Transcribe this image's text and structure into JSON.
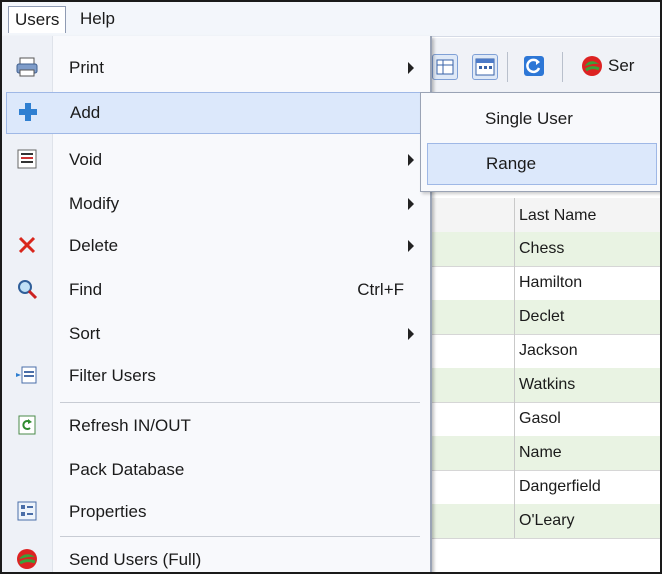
{
  "menubar": {
    "items": [
      "Users",
      "Help"
    ]
  },
  "toolbar": {
    "partial_label": "Ser"
  },
  "menu": {
    "items": [
      {
        "label": "Print",
        "icon": "printer-icon",
        "has_submenu": true
      },
      {
        "label": "Add",
        "icon": "plus-icon",
        "has_submenu": false,
        "highlighted": true
      },
      {
        "label": "Void",
        "icon": "void-icon",
        "has_submenu": true
      },
      {
        "label": "Modify",
        "icon": "",
        "has_submenu": true
      },
      {
        "label": "Delete",
        "icon": "red-x-icon",
        "has_submenu": true
      },
      {
        "label": "Find",
        "icon": "find-icon",
        "shortcut": "Ctrl+F"
      },
      {
        "label": "Sort",
        "icon": "",
        "has_submenu": true
      },
      {
        "label": "Filter Users",
        "icon": "filter-icon"
      },
      {
        "label": "Refresh IN/OUT",
        "icon": "refresh-icon"
      },
      {
        "label": "Pack Database",
        "icon": ""
      },
      {
        "label": "Properties",
        "icon": "properties-icon"
      },
      {
        "label": "Send Users (Full)",
        "icon": "send-users-icon"
      }
    ]
  },
  "submenu": {
    "items": [
      "Single User",
      "Range"
    ],
    "highlighted": "Range"
  },
  "grid": {
    "column_header": "Last Name",
    "rows": [
      "Chess",
      "Hamilton",
      "Declet",
      "Jackson",
      "Watkins",
      "Gasol",
      "Name",
      "Dangerfield",
      "O'Leary"
    ]
  },
  "colors": {
    "highlight": "#dce8fb",
    "highlight_border": "#9fb8e6",
    "row_alt": "#e9f3e3",
    "plus_blue": "#2f7fd1",
    "delete_red": "#d9261c"
  }
}
